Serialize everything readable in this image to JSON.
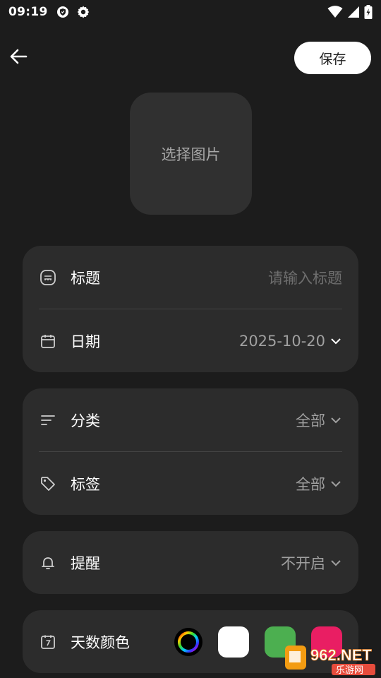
{
  "status_bar": {
    "time": "09:19"
  },
  "header": {
    "save_label": "保存"
  },
  "image_picker": {
    "label": "选择图片"
  },
  "form": {
    "title": {
      "label": "标题",
      "placeholder": "请输入标题"
    },
    "date": {
      "label": "日期",
      "value": "2025-10-20"
    },
    "category": {
      "label": "分类",
      "value": "全部"
    },
    "tag": {
      "label": "标签",
      "value": "全部"
    },
    "reminder": {
      "label": "提醒",
      "value": "不开启"
    },
    "day_color": {
      "label": "天数颜色",
      "swatches": [
        "#ffffff",
        "#4caf50",
        "#e91e63"
      ]
    }
  },
  "colors": {
    "background": "#1c1c1c",
    "card": "#2c2c2c",
    "accent_white": "#ffffff"
  },
  "watermark": {
    "line1": "962.NET",
    "line2": "乐游网"
  }
}
